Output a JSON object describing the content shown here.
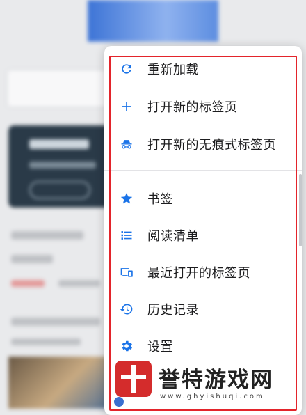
{
  "menu": {
    "items": [
      {
        "label": "重新加载",
        "icon": "reload-icon"
      },
      {
        "label": "打开新的标签页",
        "icon": "plus-icon"
      },
      {
        "label": "打开新的无痕式标签页",
        "icon": "incognito-icon"
      },
      {
        "label": "书签",
        "icon": "star-icon"
      },
      {
        "label": "阅读清单",
        "icon": "list-icon"
      },
      {
        "label": "最近打开的标签页",
        "icon": "recent-tabs-icon"
      },
      {
        "label": "历史记录",
        "icon": "history-icon"
      },
      {
        "label": "设置",
        "icon": "gear-icon"
      }
    ],
    "accent_color": "#1a73e8",
    "highlight_color": "#e3242b"
  },
  "watermark": {
    "title": "誉特游戏网",
    "url": "www.ghyishuqi.com"
  }
}
